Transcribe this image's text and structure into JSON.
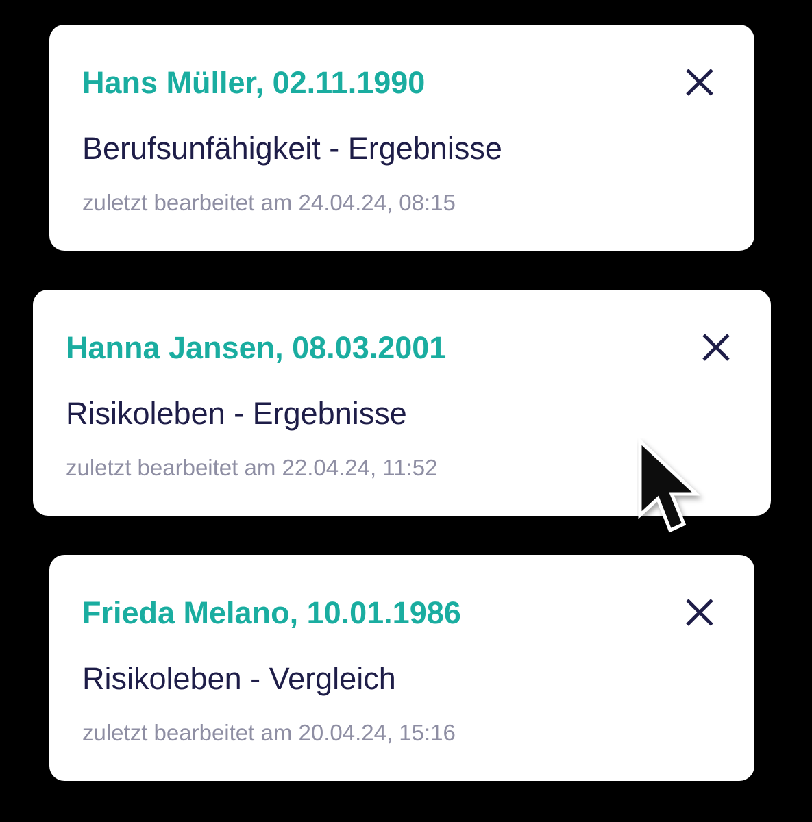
{
  "cards": [
    {
      "name": "Hans Müller, 02.11.1990",
      "subtitle": "Berufsunfähigkeit - Ergebnisse",
      "last_edited": "zuletzt bearbeitet am 24.04.24, 08:15",
      "close_icon": "close-icon"
    },
    {
      "name": "Hanna Jansen, 08.03.2001",
      "subtitle": "Risikoleben - Ergebnisse",
      "last_edited": "zuletzt bearbeitet am 22.04.24, 11:52",
      "close_icon": "close-icon"
    },
    {
      "name": "Frieda Melano, 10.01.1986",
      "subtitle": "Risikoleben - Vergleich",
      "last_edited": "zuletzt bearbeitet am 20.04.24, 15:16",
      "close_icon": "close-icon"
    }
  ],
  "colors": {
    "background": "#000000",
    "card": "#ffffff",
    "title_accent": "#1aada0",
    "subtitle_text": "#1e1d48",
    "meta_text": "#8e8ea3",
    "close_icon": "#1e1d48"
  },
  "cursor_icon": "mouse-pointer-icon"
}
